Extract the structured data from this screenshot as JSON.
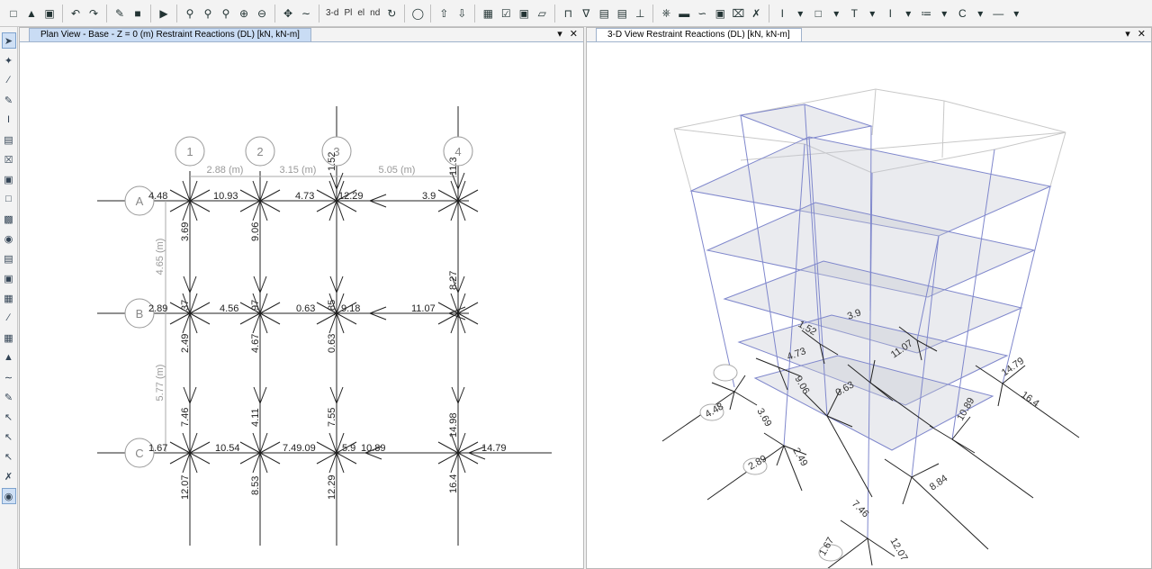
{
  "toolbar": {
    "icons": [
      "new-model",
      "open",
      "save",
      "undo",
      "redo",
      "edit",
      "lock",
      "run",
      "zoom-window",
      "zoom-in",
      "zoom-out",
      "zoom-restore",
      "zoom-previous",
      "pan",
      "rubber-band",
      "3d",
      "plan",
      "elevation",
      "nd",
      "rotate",
      "perspective",
      "up",
      "down",
      "set-display",
      "object-display",
      "display-options",
      "show-undeformed",
      "show-deformed",
      "show-loads",
      "show-forces",
      "show-reactions",
      "section",
      "toolbar-misc"
    ],
    "labels": {
      "three_d": "3-d",
      "plan": "Pl",
      "elev": "el",
      "nd": "nd"
    }
  },
  "left_pane": {
    "tab_label": "Plan View - Base - Z = 0 (m)   Restraint Reactions   (DL)  [kN, kN-m]",
    "grid_bubbles": [
      "1",
      "2",
      "3",
      "4",
      "A",
      "B",
      "C"
    ],
    "dims_x": [
      "2.88 (m)",
      "3.15 (m)",
      "5.05 (m)"
    ],
    "dims_y": [
      "4.65 (m)",
      "5.77 (m)"
    ],
    "reactions": {
      "a1": "4.48",
      "a2": "10.93",
      "a3": "4.73",
      "a3b": "12.29",
      "a4": "3.9",
      "a4v": "11.3",
      "a_v1": "3.69",
      "a_v2": "9.06",
      "a_v3": "1.52",
      "b1": "2.89",
      "b1b": "37",
      "b2": "4.56",
      "b2b": "97",
      "b3": "0.63",
      "b3b": "85",
      "b3c": "9.18",
      "b4": "11.07",
      "b4v": "8.27",
      "bv1": "2.49",
      "bv2": "4.67",
      "bv3": "0.63",
      "c1": "1.67",
      "c2": "10.54",
      "c3": "7.49.09",
      "c3b": "5.9",
      "c3c": "10.89",
      "c4": "14.79",
      "cv1": "7.46",
      "cv2": "4.11",
      "cv3": "7.55",
      "cv4": "14.98",
      "cd1": "12.07",
      "cd2": "8.53",
      "cd3": "12.29",
      "cd4": "16.4"
    }
  },
  "right_pane": {
    "tab_label": "3-D View   Restraint Reactions   (DL)  [kN, kN-m]",
    "labels": [
      "4.48",
      "3.69",
      "2.89",
      "2.49",
      "1.67",
      "7.46",
      "14.79",
      "16.4",
      "10.89",
      "12.07",
      "9.06",
      "0.63",
      "8.84",
      "11.07",
      "1.52",
      "3.9",
      "4.73"
    ]
  },
  "window_controls": {
    "menu": "▾",
    "close": "✕"
  },
  "colors": {
    "frame": "#7f87cc",
    "ghost": "#c8c8c8",
    "slab": "rgba(200,200,200,0.35)",
    "arrow": "#222222",
    "grid": "#222222",
    "tab_active": "#c9dcf4"
  }
}
